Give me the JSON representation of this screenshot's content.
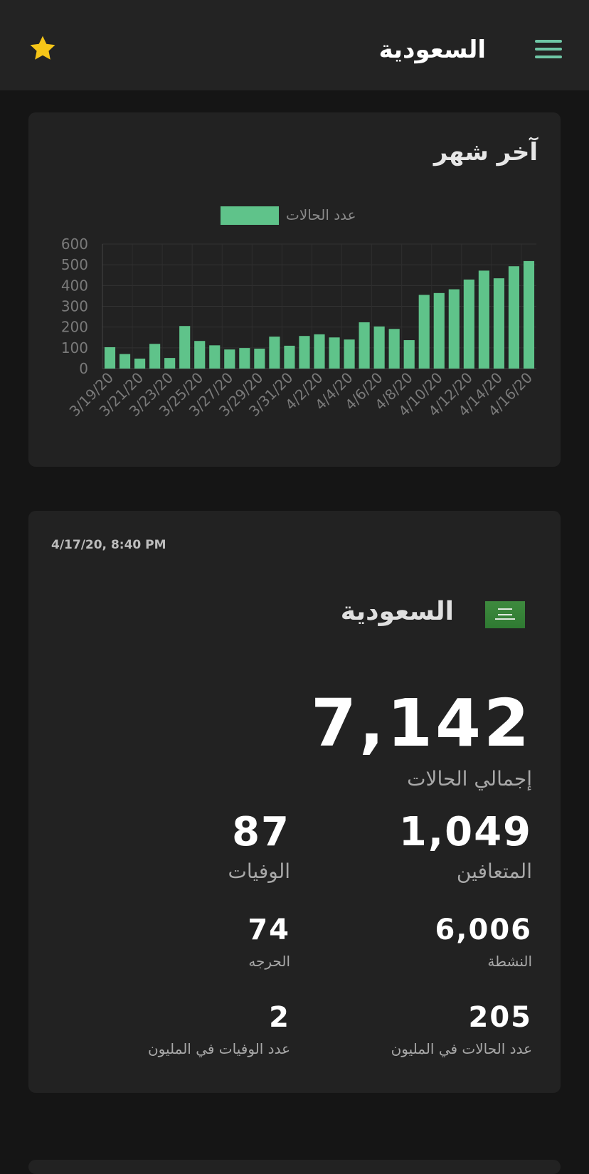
{
  "header": {
    "title": "السعودية",
    "menu_icon": "hamburger-menu-icon",
    "favorite_icon": "star-icon",
    "accent_color": "#6fc6a6",
    "star_color": "#f5c518"
  },
  "chart_card": {
    "title": "آخر شهر"
  },
  "chart_data": {
    "type": "bar",
    "legend": [
      "عدد الحالات"
    ],
    "bar_color": "#5fc38a",
    "ylim": [
      0,
      600
    ],
    "yticks": [
      "0",
      "100",
      "200",
      "300",
      "400",
      "500",
      "600"
    ],
    "categories": [
      "3/19/20",
      "3/20/20",
      "3/21/20",
      "3/22/20",
      "3/23/20",
      "3/24/20",
      "3/25/20",
      "3/26/20",
      "3/27/20",
      "3/28/20",
      "3/29/20",
      "3/30/20",
      "3/31/20",
      "4/1/20",
      "4/2/20",
      "4/3/20",
      "4/4/20",
      "4/5/20",
      "4/6/20",
      "4/7/20",
      "4/8/20",
      "4/9/20",
      "4/10/20",
      "4/11/20",
      "4/12/20",
      "4/13/20",
      "4/14/20",
      "4/15/20",
      "4/16/20"
    ],
    "xtick_labels": [
      "3/19/20",
      "3/21/20",
      "3/23/20",
      "3/25/20",
      "3/27/20",
      "3/29/20",
      "3/31/20",
      "4/2/20",
      "4/4/20",
      "4/6/20",
      "4/8/20",
      "4/10/20",
      "4/12/20",
      "4/14/20",
      "4/16/20"
    ],
    "series": [
      {
        "name": "عدد الحالات",
        "values": [
          103,
          70,
          48,
          119,
          51,
          205,
          133,
          112,
          92,
          99,
          96,
          154,
          110,
          157,
          165,
          150,
          140,
          223,
          203,
          191,
          137,
          355,
          364,
          382,
          429,
          472,
          435,
          493,
          518
        ]
      }
    ],
    "grid": true
  },
  "stats_card": {
    "timestamp": "4/17/20, 8:40 PM",
    "country": "السعودية",
    "flag_icon": "saudi-arabia-flag-icon",
    "total_cases": "7,142",
    "total_cases_label": "إجمالي الحالات",
    "recovered": "1,049",
    "recovered_label": "المتعافين",
    "deaths": "87",
    "deaths_label": "الوفيات",
    "active": "6,006",
    "active_label": "النشطة",
    "critical": "74",
    "critical_label": "الحرجه",
    "cases_per_million": "205",
    "cases_per_million_label": "عدد الحالات في المليون",
    "deaths_per_million": "2",
    "deaths_per_million_label": "عدد الوفيات في المليون"
  }
}
